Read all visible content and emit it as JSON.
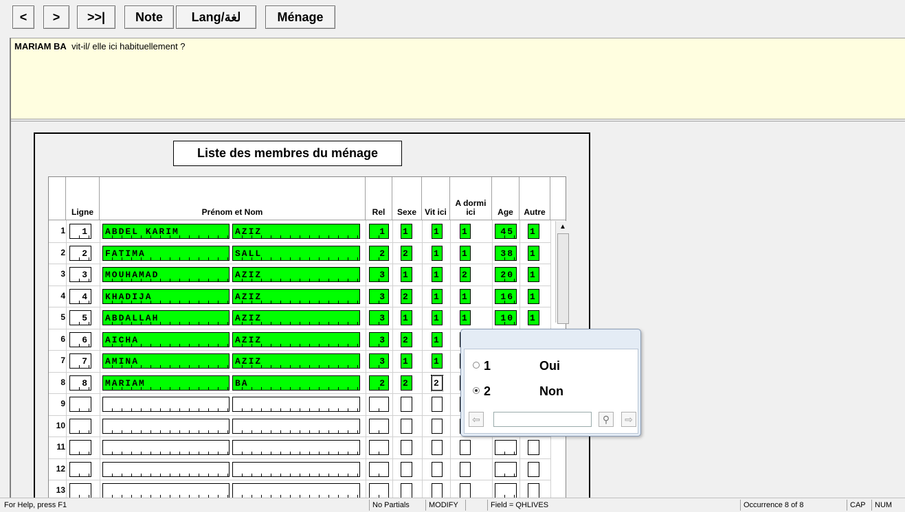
{
  "toolbar": {
    "prev_label": "<",
    "next_label": ">",
    "last_label": ">>|",
    "note_label": "Note",
    "lang_label": "Lang/لغة",
    "menage_label": "Ménage"
  },
  "question": {
    "subject": "MARIAM BA",
    "text": "vit-il/ elle ici habituellement ?"
  },
  "roster": {
    "title": "Liste des membres du ménage",
    "columns": {
      "ligne": "Ligne",
      "nom": "Prénom et Nom",
      "rel": "Rel",
      "sexe": "Sexe",
      "vit_ici": "Vit ici",
      "dormi_ici": "A dormi ici",
      "age": "Age",
      "autre": "Autre"
    },
    "rows": [
      {
        "num": "1",
        "ligne": "1",
        "prenom": "ABDEL KARIM",
        "nom": "AZIZ",
        "rel": "1",
        "sexe": "1",
        "vit": "1",
        "dormi": "1",
        "age": "45",
        "autre": "1"
      },
      {
        "num": "2",
        "ligne": "2",
        "prenom": "FATIMA",
        "nom": "SALL",
        "rel": "2",
        "sexe": "2",
        "vit": "1",
        "dormi": "1",
        "age": "38",
        "autre": "1"
      },
      {
        "num": "3",
        "ligne": "3",
        "prenom": "MOUHAMAD",
        "nom": "AZIZ",
        "rel": "3",
        "sexe": "1",
        "vit": "1",
        "dormi": "2",
        "age": "20",
        "autre": "1"
      },
      {
        "num": "4",
        "ligne": "4",
        "prenom": "KHADIJA",
        "nom": "AZIZ",
        "rel": "3",
        "sexe": "2",
        "vit": "1",
        "dormi": "1",
        "age": "16",
        "autre": "1"
      },
      {
        "num": "5",
        "ligne": "5",
        "prenom": "ABDALLAH",
        "nom": "AZIZ",
        "rel": "3",
        "sexe": "1",
        "vit": "1",
        "dormi": "1",
        "age": "10",
        "autre": "1"
      },
      {
        "num": "6",
        "ligne": "6",
        "prenom": "AICHA",
        "nom": "AZIZ",
        "rel": "3",
        "sexe": "2",
        "vit": "1",
        "dormi": "",
        "age": "",
        "autre": ""
      },
      {
        "num": "7",
        "ligne": "7",
        "prenom": "AMINA",
        "nom": "AZIZ",
        "rel": "3",
        "sexe": "1",
        "vit": "1",
        "dormi": "",
        "age": "",
        "autre": ""
      },
      {
        "num": "8",
        "ligne": "8",
        "prenom": "MARIAM",
        "nom": "BA",
        "rel": "2",
        "sexe": "2",
        "vit": "2",
        "dormi": "",
        "age": "",
        "autre": ""
      },
      {
        "num": "9",
        "ligne": "",
        "prenom": "",
        "nom": "",
        "rel": "",
        "sexe": "",
        "vit": "",
        "dormi": "",
        "age": "",
        "autre": ""
      },
      {
        "num": "10",
        "ligne": "",
        "prenom": "",
        "nom": "",
        "rel": "",
        "sexe": "",
        "vit": "",
        "dormi": "",
        "age": "",
        "autre": ""
      },
      {
        "num": "11",
        "ligne": "",
        "prenom": "",
        "nom": "",
        "rel": "",
        "sexe": "",
        "vit": "",
        "dormi": "",
        "age": "",
        "autre": ""
      },
      {
        "num": "12",
        "ligne": "",
        "prenom": "",
        "nom": "",
        "rel": "",
        "sexe": "",
        "vit": "",
        "dormi": "",
        "age": "",
        "autre": ""
      },
      {
        "num": "13",
        "ligne": "",
        "prenom": "",
        "nom": "",
        "rel": "",
        "sexe": "",
        "vit": "",
        "dormi": "",
        "age": "",
        "autre": ""
      }
    ]
  },
  "popup": {
    "options": [
      {
        "code": "1",
        "label": "Oui",
        "selected": false
      },
      {
        "code": "2",
        "label": "Non",
        "selected": true
      }
    ]
  },
  "status": {
    "help": "For Help, press F1",
    "partials": "No Partials",
    "mode": "MODIFY",
    "field": "Field = QHLIVES",
    "occurrence": "Occurrence 8 of 8",
    "cap": "CAP",
    "num": "NUM"
  },
  "colors": {
    "filled_cell": "#00ff00",
    "question_bg": "#fffee0"
  }
}
